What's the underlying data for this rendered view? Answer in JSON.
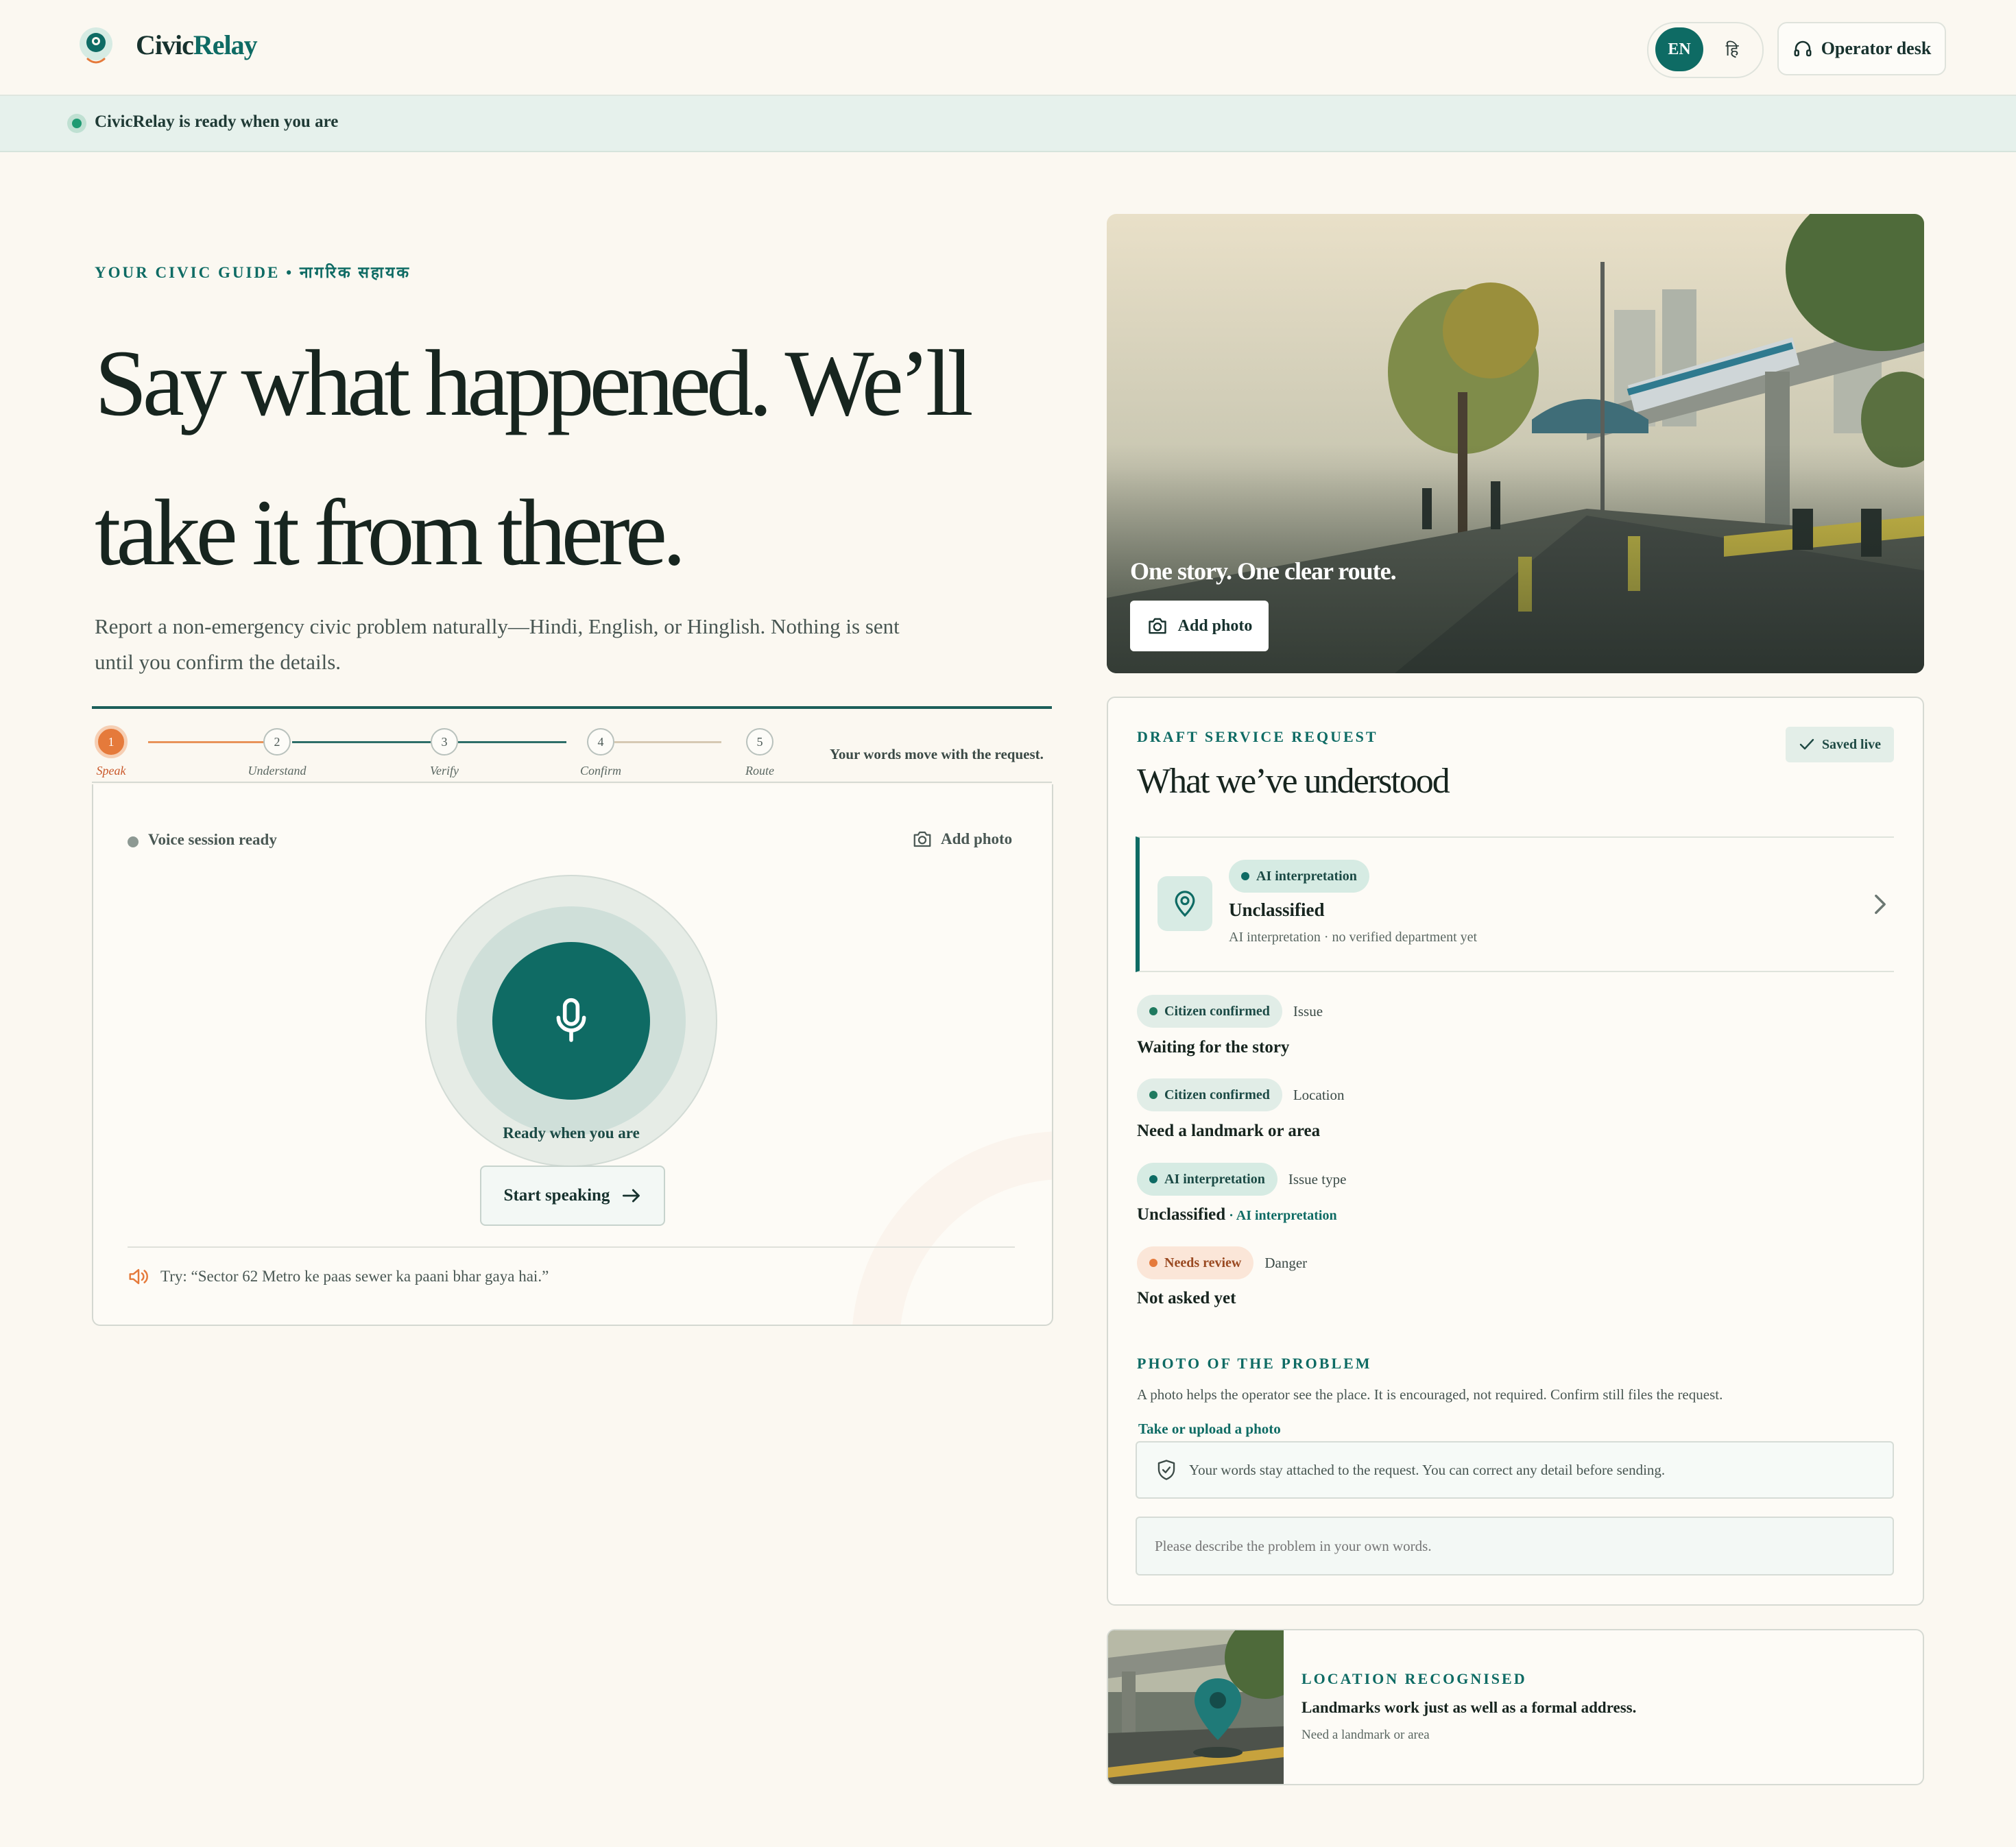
{
  "brand": {
    "name_part1": "Civic",
    "name_part2": "Relay"
  },
  "header": {
    "lang_en": "EN",
    "lang_hi": "हि",
    "operator_desk": "Operator desk"
  },
  "status": {
    "text": "CivicRelay is ready when you are"
  },
  "hero": {
    "eyebrow": "YOUR CIVIC GUIDE • नागरिक सहायक",
    "headline_line1": "Say what happened. We’ll",
    "headline_line2": "take it from there.",
    "subcopy": "Report a non-emergency civic problem naturally—Hindi, English, or Hinglish. Nothing is sent until you confirm the details.",
    "image_caption": "One story. One clear route.",
    "image_add_photo": "Add photo"
  },
  "stepper": {
    "steps": [
      {
        "num": "1",
        "label": "Speak"
      },
      {
        "num": "2",
        "label": "Understand"
      },
      {
        "num": "3",
        "label": "Verify"
      },
      {
        "num": "4",
        "label": "Confirm"
      },
      {
        "num": "5",
        "label": "Route"
      }
    ],
    "current_step": 1,
    "note": "Your words move with the request."
  },
  "voice": {
    "status": "Voice session ready",
    "add_photo": "Add photo",
    "ready_label": "Ready when you are",
    "start_button": "Start speaking",
    "try_text": "Try: “Sector 62 Metro ke paas sewer ka paani bhar gaya hai.”"
  },
  "draft": {
    "eyebrow": "DRAFT SERVICE REQUEST",
    "saved_badge": "Saved live",
    "title": "What we’ve understood",
    "ai_card": {
      "pill": "AI interpretation",
      "title": "Unclassified",
      "subtitle": "AI interpretation · no verified department yet"
    },
    "fields": [
      {
        "pill": "Citizen confirmed",
        "pill_kind": "confirmed",
        "key": "Issue",
        "value": "Waiting for the story",
        "value_sub": ""
      },
      {
        "pill": "Citizen confirmed",
        "pill_kind": "confirmed",
        "key": "Location",
        "value": "Need a landmark or area",
        "value_sub": ""
      },
      {
        "pill": "AI interpretation",
        "pill_kind": "ai",
        "key": "Issue type",
        "value": "Unclassified",
        "value_sub": " · AI interpretation"
      },
      {
        "pill": "Needs review",
        "pill_kind": "review",
        "key": "Danger",
        "value": "Not asked yet",
        "value_sub": ""
      }
    ],
    "photo": {
      "eyebrow": "PHOTO OF THE PROBLEM",
      "description": "A photo helps the operator see the place. It is encouraged, not required. Confirm still files the request.",
      "link": "Take or upload a photo",
      "note": "Your words stay attached to the request. You can correct any detail before sending.",
      "input_placeholder": "Please describe the problem in your own words."
    }
  },
  "location": {
    "eyebrow": "LOCATION RECOGNISED",
    "title": "Landmarks work just as well as a formal address.",
    "subtitle": "Need a landmark or area"
  },
  "colors": {
    "accent": "#0e6b64",
    "orange": "#e57a3b",
    "background": "#fbf8f1",
    "ai_pill": "#d6ebe3",
    "review_pill": "#fbe6d8"
  }
}
